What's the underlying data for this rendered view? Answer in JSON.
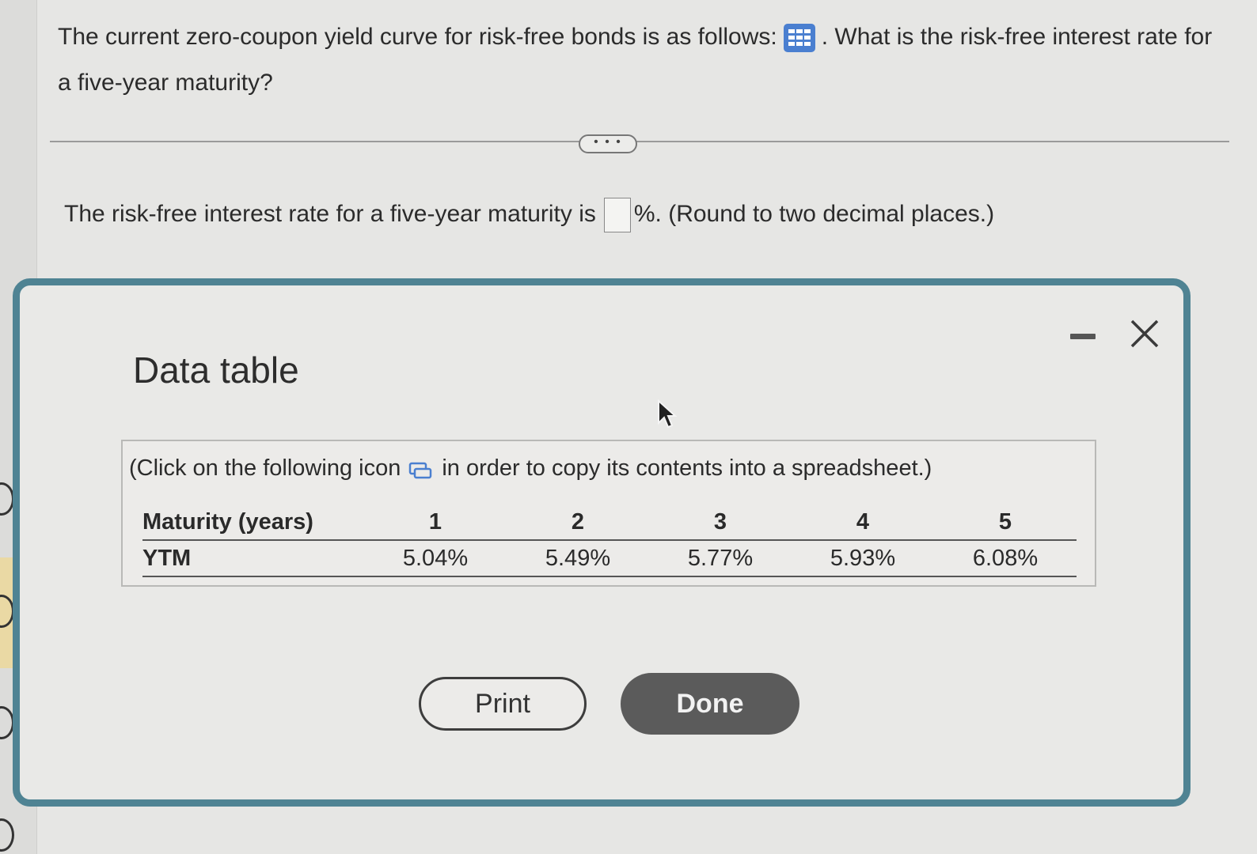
{
  "question": {
    "text_before_icon": "The current zero-coupon yield curve for risk-free bonds is as follows:",
    "text_after_icon": ". What is the risk-free interest rate for a five-year maturity?"
  },
  "more_button": "• • •",
  "answer": {
    "prefix": "The risk-free interest rate for a five-year maturity is",
    "input_value": "",
    "suffix": "%. (Round to two decimal places.)"
  },
  "dialog": {
    "title": "Data table",
    "instruction_before_icon": "(Click on the following icon",
    "instruction_after_icon": "in order to copy its contents into a spreadsheet.)",
    "table": {
      "header_label": "Maturity (years)",
      "row_label": "YTM",
      "maturities": [
        "1",
        "2",
        "3",
        "4",
        "5"
      ],
      "ytm": [
        "5.04%",
        "5.49%",
        "5.77%",
        "5.93%",
        "6.08%"
      ]
    },
    "print_label": "Print",
    "done_label": "Done"
  },
  "colors": {
    "dialog_border": "#4f8393",
    "grid_icon": "#4a7fd0",
    "done_button": "#5b5b5b"
  },
  "icons": [
    "table-grid-icon",
    "copy-icon",
    "minimize-icon",
    "close-icon",
    "mouse-cursor-icon"
  ]
}
